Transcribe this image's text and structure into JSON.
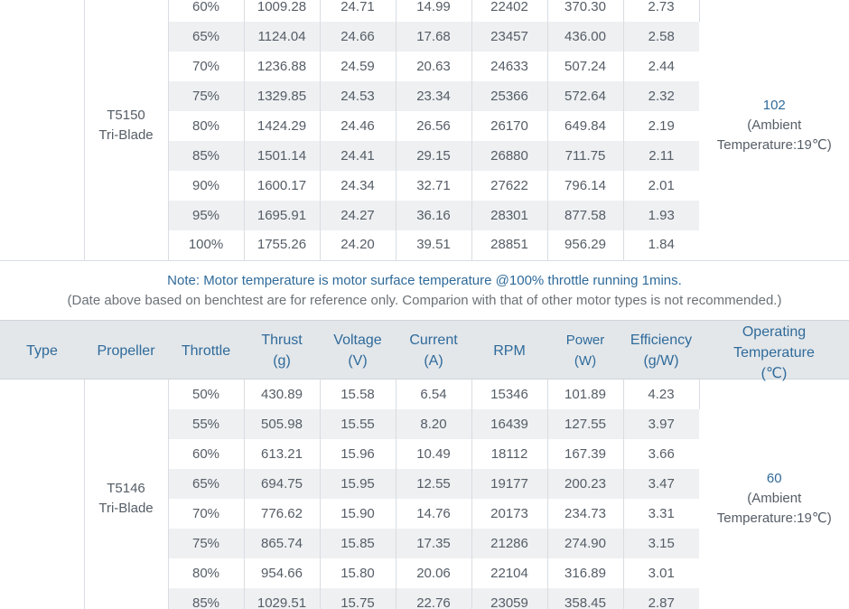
{
  "table1": {
    "propeller_line1": "T5150",
    "propeller_line2": "Tri-Blade",
    "temp_value": "102",
    "temp_note1": "(Ambient",
    "temp_note2": "Temperature:19℃)",
    "rows": [
      [
        "60%",
        "1009.28",
        "24.71",
        "14.99",
        "22402",
        "370.30",
        "2.73"
      ],
      [
        "65%",
        "1124.04",
        "24.66",
        "17.68",
        "23457",
        "436.00",
        "2.58"
      ],
      [
        "70%",
        "1236.88",
        "24.59",
        "20.63",
        "24633",
        "507.24",
        "2.44"
      ],
      [
        "75%",
        "1329.85",
        "24.53",
        "23.34",
        "25366",
        "572.64",
        "2.32"
      ],
      [
        "80%",
        "1424.29",
        "24.46",
        "26.56",
        "26170",
        "649.84",
        "2.19"
      ],
      [
        "85%",
        "1501.14",
        "24.41",
        "29.15",
        "26880",
        "711.75",
        "2.11"
      ],
      [
        "90%",
        "1600.17",
        "24.34",
        "32.71",
        "27622",
        "796.14",
        "2.01"
      ],
      [
        "95%",
        "1695.91",
        "24.27",
        "36.16",
        "28301",
        "877.58",
        "1.93"
      ],
      [
        "100%",
        "1755.26",
        "24.20",
        "39.51",
        "28851",
        "956.29",
        "1.84"
      ]
    ]
  },
  "note": {
    "line1": "Note: Motor temperature is motor surface temperature @100% throttle running 1mins.",
    "line2": "(Date above based on benchtest are for reference only. Comparion with that of other motor types is not recommended.)"
  },
  "header": {
    "type": "Type",
    "propeller": "Propeller",
    "throttle": "Throttle",
    "thrust": "Thrust",
    "thrust_unit": "(g)",
    "voltage": "Voltage",
    "voltage_unit": "(V)",
    "current": "Current",
    "current_unit": "(A)",
    "rpm": "RPM",
    "power": "Power",
    "power_unit": "(W)",
    "efficiency": "Efficiency",
    "efficiency_unit": "(g/W)",
    "op_temp_1": "Operating",
    "op_temp_2": "Temperature",
    "op_temp_3": "(℃)"
  },
  "table2": {
    "propeller_line1": "T5146",
    "propeller_line2": "Tri-Blade",
    "temp_value": "60",
    "temp_note1": "(Ambient",
    "temp_note2": "Temperature:19℃)",
    "rows": [
      [
        "50%",
        "430.89",
        "15.58",
        "6.54",
        "15346",
        "101.89",
        "4.23"
      ],
      [
        "55%",
        "505.98",
        "15.55",
        "8.20",
        "16439",
        "127.55",
        "3.97"
      ],
      [
        "60%",
        "613.21",
        "15.96",
        "10.49",
        "18112",
        "167.39",
        "3.66"
      ],
      [
        "65%",
        "694.75",
        "15.95",
        "12.55",
        "19177",
        "200.23",
        "3.47"
      ],
      [
        "70%",
        "776.62",
        "15.90",
        "14.76",
        "20173",
        "234.73",
        "3.31"
      ],
      [
        "75%",
        "865.74",
        "15.85",
        "17.35",
        "21286",
        "274.90",
        "3.15"
      ],
      [
        "80%",
        "954.66",
        "15.80",
        "20.06",
        "22104",
        "316.89",
        "3.01"
      ],
      [
        "85%",
        "1029.51",
        "15.75",
        "22.76",
        "23059",
        "358.45",
        "2.87"
      ]
    ]
  }
}
